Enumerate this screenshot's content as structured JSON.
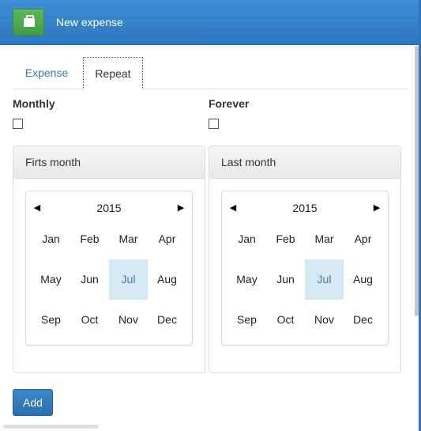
{
  "header": {
    "title": "New expense",
    "icon": "shopping-bag-icon",
    "brand_color": "#337ab7",
    "button_color": "#5cb85c"
  },
  "tabs": [
    {
      "label": "Expense",
      "active": false
    },
    {
      "label": "Repeat",
      "active": true
    }
  ],
  "fields": {
    "monthly_label": "Monthly",
    "monthly_checked": false,
    "forever_label": "Forever",
    "forever_checked": false
  },
  "first_month": {
    "heading": "Firts month",
    "year": "2015",
    "selected": "Jul",
    "months": [
      "Jan",
      "Feb",
      "Mar",
      "Apr",
      "May",
      "Jun",
      "Jul",
      "Aug",
      "Sep",
      "Oct",
      "Nov",
      "Dec"
    ],
    "prev_label": "◀",
    "next_label": "▶"
  },
  "last_month": {
    "heading": "Last month",
    "year": "2015",
    "selected": "Jul",
    "months": [
      "Jan",
      "Feb",
      "Mar",
      "Apr",
      "May",
      "Jun",
      "Jul",
      "Aug",
      "Sep",
      "Oct",
      "Nov",
      "Dec"
    ],
    "prev_label": "◀",
    "next_label": "▶"
  },
  "actions": {
    "add_label": "Add"
  }
}
